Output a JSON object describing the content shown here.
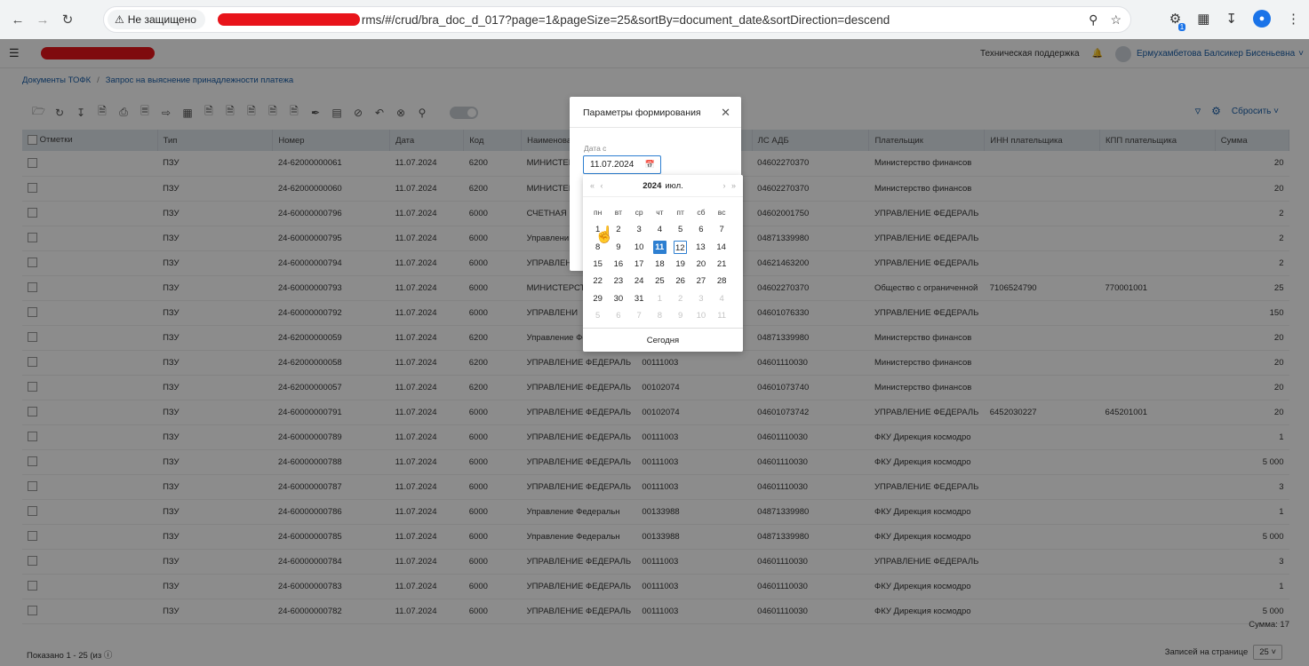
{
  "browser": {
    "security_label": "Не защищено",
    "url_visible": "rms/#/crud/bra_doc_d_017?page=1&pageSize=25&sortBy=document_date&sortDirection=descend",
    "extension_badge": "1"
  },
  "appbar": {
    "support": "Техническая поддержка",
    "user_name": "Ермухамбетова Балсикер Бисеньевна"
  },
  "breadcrumb": {
    "root": "Документы ТОФК",
    "current": "Запрос на выяснение принадлежности платежа"
  },
  "toolbar": {
    "reset": "Сбросить"
  },
  "table": {
    "headers": [
      "Отметки",
      "Тип",
      "Номер",
      "Дата",
      "Код",
      "Наименова",
      "",
      "ЛС АДБ",
      "Плательщик",
      "ИНН плательщика",
      "КПП плательщика",
      "Сумма"
    ],
    "rows": [
      [
        "",
        "ПЗУ",
        "24-62000000061",
        "11.07.2024",
        "6200",
        "МИНИСТЕРСТ",
        "",
        "04602270370",
        "Министерство финансов",
        "",
        "",
        "20"
      ],
      [
        "",
        "ПЗУ",
        "24-62000000060",
        "11.07.2024",
        "6200",
        "МИНИСТЕРСТ",
        "",
        "04602270370",
        "Министерство финансов",
        "",
        "",
        "20"
      ],
      [
        "",
        "ПЗУ",
        "24-60000000796",
        "11.07.2024",
        "6000",
        "СЧЕТНАЯ П",
        "",
        "04602001750",
        "УПРАВЛЕНИЕ ФЕДЕРАЛЬ",
        "",
        "",
        "2"
      ],
      [
        "",
        "ПЗУ",
        "24-60000000795",
        "11.07.2024",
        "6000",
        "Управлени",
        "",
        "04871339980",
        "УПРАВЛЕНИЕ ФЕДЕРАЛЬ",
        "",
        "",
        "2"
      ],
      [
        "",
        "ПЗУ",
        "24-60000000794",
        "11.07.2024",
        "6000",
        "УПРАВЛЕН",
        "",
        "04621463200",
        "УПРАВЛЕНИЕ ФЕДЕРАЛЬ",
        "",
        "",
        "2"
      ],
      [
        "",
        "ПЗУ",
        "24-60000000793",
        "11.07.2024",
        "6000",
        "МИНИСТЕРСТ",
        "",
        "04602270370",
        "Общество с ограниченной",
        "7106524790",
        "770001001",
        "25"
      ],
      [
        "",
        "ПЗУ",
        "24-60000000792",
        "11.07.2024",
        "6000",
        "УПРАВЛЕНИ",
        "",
        "04601076330",
        "УПРАВЛЕНИЕ ФЕДЕРАЛЬ",
        "",
        "",
        "150"
      ],
      [
        "",
        "ПЗУ",
        "24-62000000059",
        "11.07.2024",
        "6200",
        "Управление Фе",
        "",
        "04871339980",
        "Министерство финансов",
        "",
        "",
        "20"
      ],
      [
        "",
        "ПЗУ",
        "24-62000000058",
        "11.07.2024",
        "6200",
        "УПРАВЛЕНИЕ ФЕДЕРАЛЬ",
        "00111003",
        "04601110030",
        "Министерство финансов",
        "",
        "",
        "20"
      ],
      [
        "",
        "ПЗУ",
        "24-62000000057",
        "11.07.2024",
        "6200",
        "УПРАВЛЕНИЕ ФЕДЕРАЛЬ",
        "00102074",
        "04601073740",
        "Министерство финансов",
        "",
        "",
        "20"
      ],
      [
        "",
        "ПЗУ",
        "24-60000000791",
        "11.07.2024",
        "6000",
        "УПРАВЛЕНИЕ ФЕДЕРАЛЬ",
        "00102074",
        "04601073742",
        "УПРАВЛЕНИЕ ФЕДЕРАЛЬ",
        "6452030227",
        "645201001",
        "20"
      ],
      [
        "",
        "ПЗУ",
        "24-60000000789",
        "11.07.2024",
        "6000",
        "УПРАВЛЕНИЕ ФЕДЕРАЛЬ",
        "00111003",
        "04601110030",
        "ФКУ Дирекция космодро",
        "",
        "",
        "1"
      ],
      [
        "",
        "ПЗУ",
        "24-60000000788",
        "11.07.2024",
        "6000",
        "УПРАВЛЕНИЕ ФЕДЕРАЛЬ",
        "00111003",
        "04601110030",
        "ФКУ Дирекция космодро",
        "",
        "",
        "5 000"
      ],
      [
        "",
        "ПЗУ",
        "24-60000000787",
        "11.07.2024",
        "6000",
        "УПРАВЛЕНИЕ ФЕДЕРАЛЬ",
        "00111003",
        "04601110030",
        "УПРАВЛЕНИЕ ФЕДЕРАЛЬ",
        "",
        "",
        "3"
      ],
      [
        "",
        "ПЗУ",
        "24-60000000786",
        "11.07.2024",
        "6000",
        "Управление Федеральн",
        "00133988",
        "04871339980",
        "ФКУ Дирекция космодро",
        "",
        "",
        "1"
      ],
      [
        "",
        "ПЗУ",
        "24-60000000785",
        "11.07.2024",
        "6000",
        "Управление Федеральн",
        "00133988",
        "04871339980",
        "ФКУ Дирекция космодро",
        "",
        "",
        "5 000"
      ],
      [
        "",
        "ПЗУ",
        "24-60000000784",
        "11.07.2024",
        "6000",
        "УПРАВЛЕНИЕ ФЕДЕРАЛЬ",
        "00111003",
        "04601110030",
        "УПРАВЛЕНИЕ ФЕДЕРАЛЬ",
        "",
        "",
        "3"
      ],
      [
        "",
        "ПЗУ",
        "24-60000000783",
        "11.07.2024",
        "6000",
        "УПРАВЛЕНИЕ ФЕДЕРАЛЬ",
        "00111003",
        "04601110030",
        "ФКУ Дирекция космодро",
        "",
        "",
        "1"
      ],
      [
        "",
        "ПЗУ",
        "24-60000000782",
        "11.07.2024",
        "6000",
        "УПРАВЛЕНИЕ ФЕДЕРАЛЬ",
        "00111003",
        "04601110030",
        "ФКУ Дирекция космодро",
        "",
        "",
        "5 000"
      ]
    ]
  },
  "footer": {
    "sum": "Сумма: 17",
    "shown": "Показано 1 - 25 (из",
    "per_page_label": "Записей на странице",
    "per_page_value": "25"
  },
  "modal": {
    "title": "Параметры формирования",
    "field_label": "Дата с",
    "field_value": "11.07.2024"
  },
  "calendar": {
    "year": "2024",
    "month": "июл.",
    "weekdays": [
      "пн",
      "вт",
      "ср",
      "чт",
      "пт",
      "сб",
      "вс"
    ],
    "weeks": [
      [
        "1",
        "2",
        "3",
        "4",
        "5",
        "6",
        "7"
      ],
      [
        "8",
        "9",
        "10",
        "11",
        "12",
        "13",
        "14"
      ],
      [
        "15",
        "16",
        "17",
        "18",
        "19",
        "20",
        "21"
      ],
      [
        "22",
        "23",
        "24",
        "25",
        "26",
        "27",
        "28"
      ],
      [
        "29",
        "30",
        "31",
        "1",
        "2",
        "3",
        "4"
      ],
      [
        "5",
        "6",
        "7",
        "8",
        "9",
        "10",
        "11"
      ]
    ],
    "selected_day": "11",
    "today_day": "12",
    "today_button": "Сегодня"
  }
}
